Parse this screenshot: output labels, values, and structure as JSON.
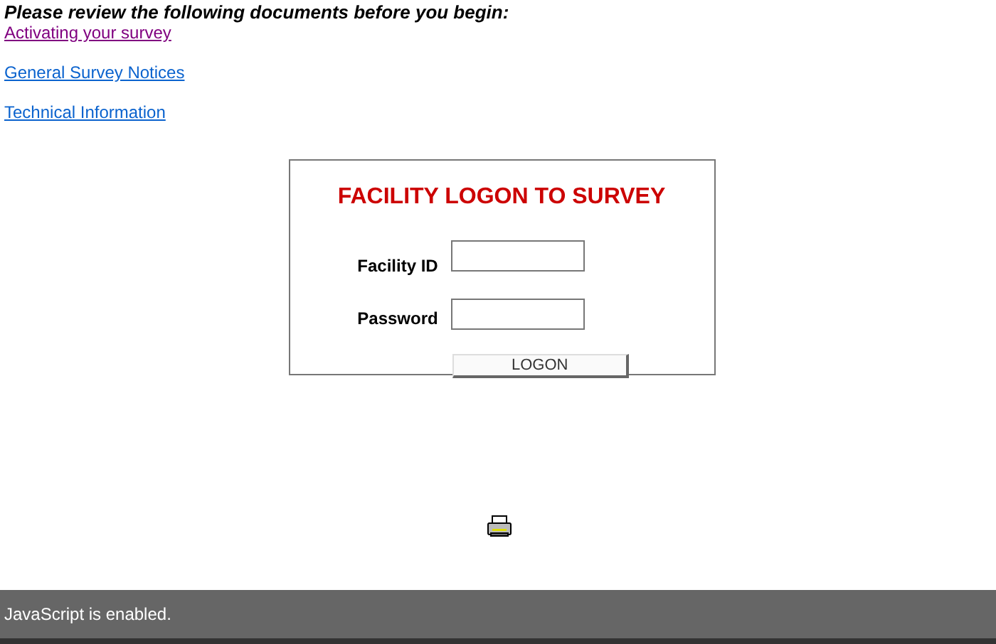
{
  "intro": "Please review the following documents before you begin:",
  "links": [
    {
      "label": "Activating your survey",
      "visited": true
    },
    {
      "label": "General Survey Notices",
      "visited": false
    },
    {
      "label": "Technical Information",
      "visited": false
    }
  ],
  "logon": {
    "title": "FACILITY LOGON TO SURVEY",
    "fields": [
      {
        "label": "Facility ID"
      },
      {
        "label": "Password"
      }
    ],
    "button": "LOGON"
  },
  "status_bar": "JavaScript is enabled."
}
